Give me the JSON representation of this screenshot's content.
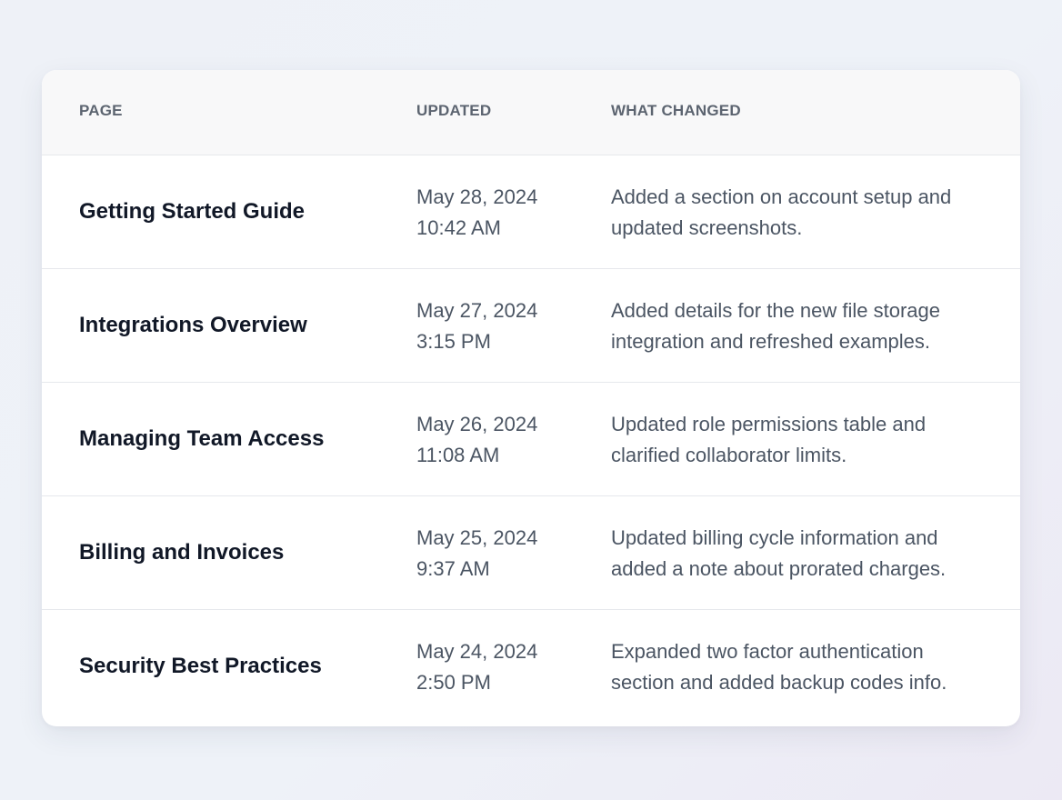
{
  "table": {
    "headers": {
      "page": "PAGE",
      "updated": "UPDATED",
      "what_changed": "WHAT CHANGED"
    },
    "rows": [
      {
        "page": "Getting Started Guide",
        "date": "May 28, 2024",
        "time": "10:42 AM",
        "change_line1": "Added a section on account setup and",
        "change_line2": "updated screenshots."
      },
      {
        "page": "Integrations Overview",
        "date": "May 27, 2024",
        "time": "3:15 PM",
        "change_line1": "Added details for the new file storage",
        "change_line2": "integration and refreshed examples."
      },
      {
        "page": "Managing Team Access",
        "date": "May 26, 2024",
        "time": "11:08 AM",
        "change_line1": "Updated role permissions table and",
        "change_line2": "clarified collaborator limits."
      },
      {
        "page": "Billing and Invoices",
        "date": "May 25, 2024",
        "time": "9:37 AM",
        "change_line1": "Updated billing cycle information and",
        "change_line2": "added a note about prorated charges."
      },
      {
        "page": "Security Best Practices",
        "date": "May 24, 2024",
        "time": "2:50 PM",
        "change_line1": "Expanded two factor authentication",
        "change_line2": "section and added backup codes info."
      }
    ]
  }
}
